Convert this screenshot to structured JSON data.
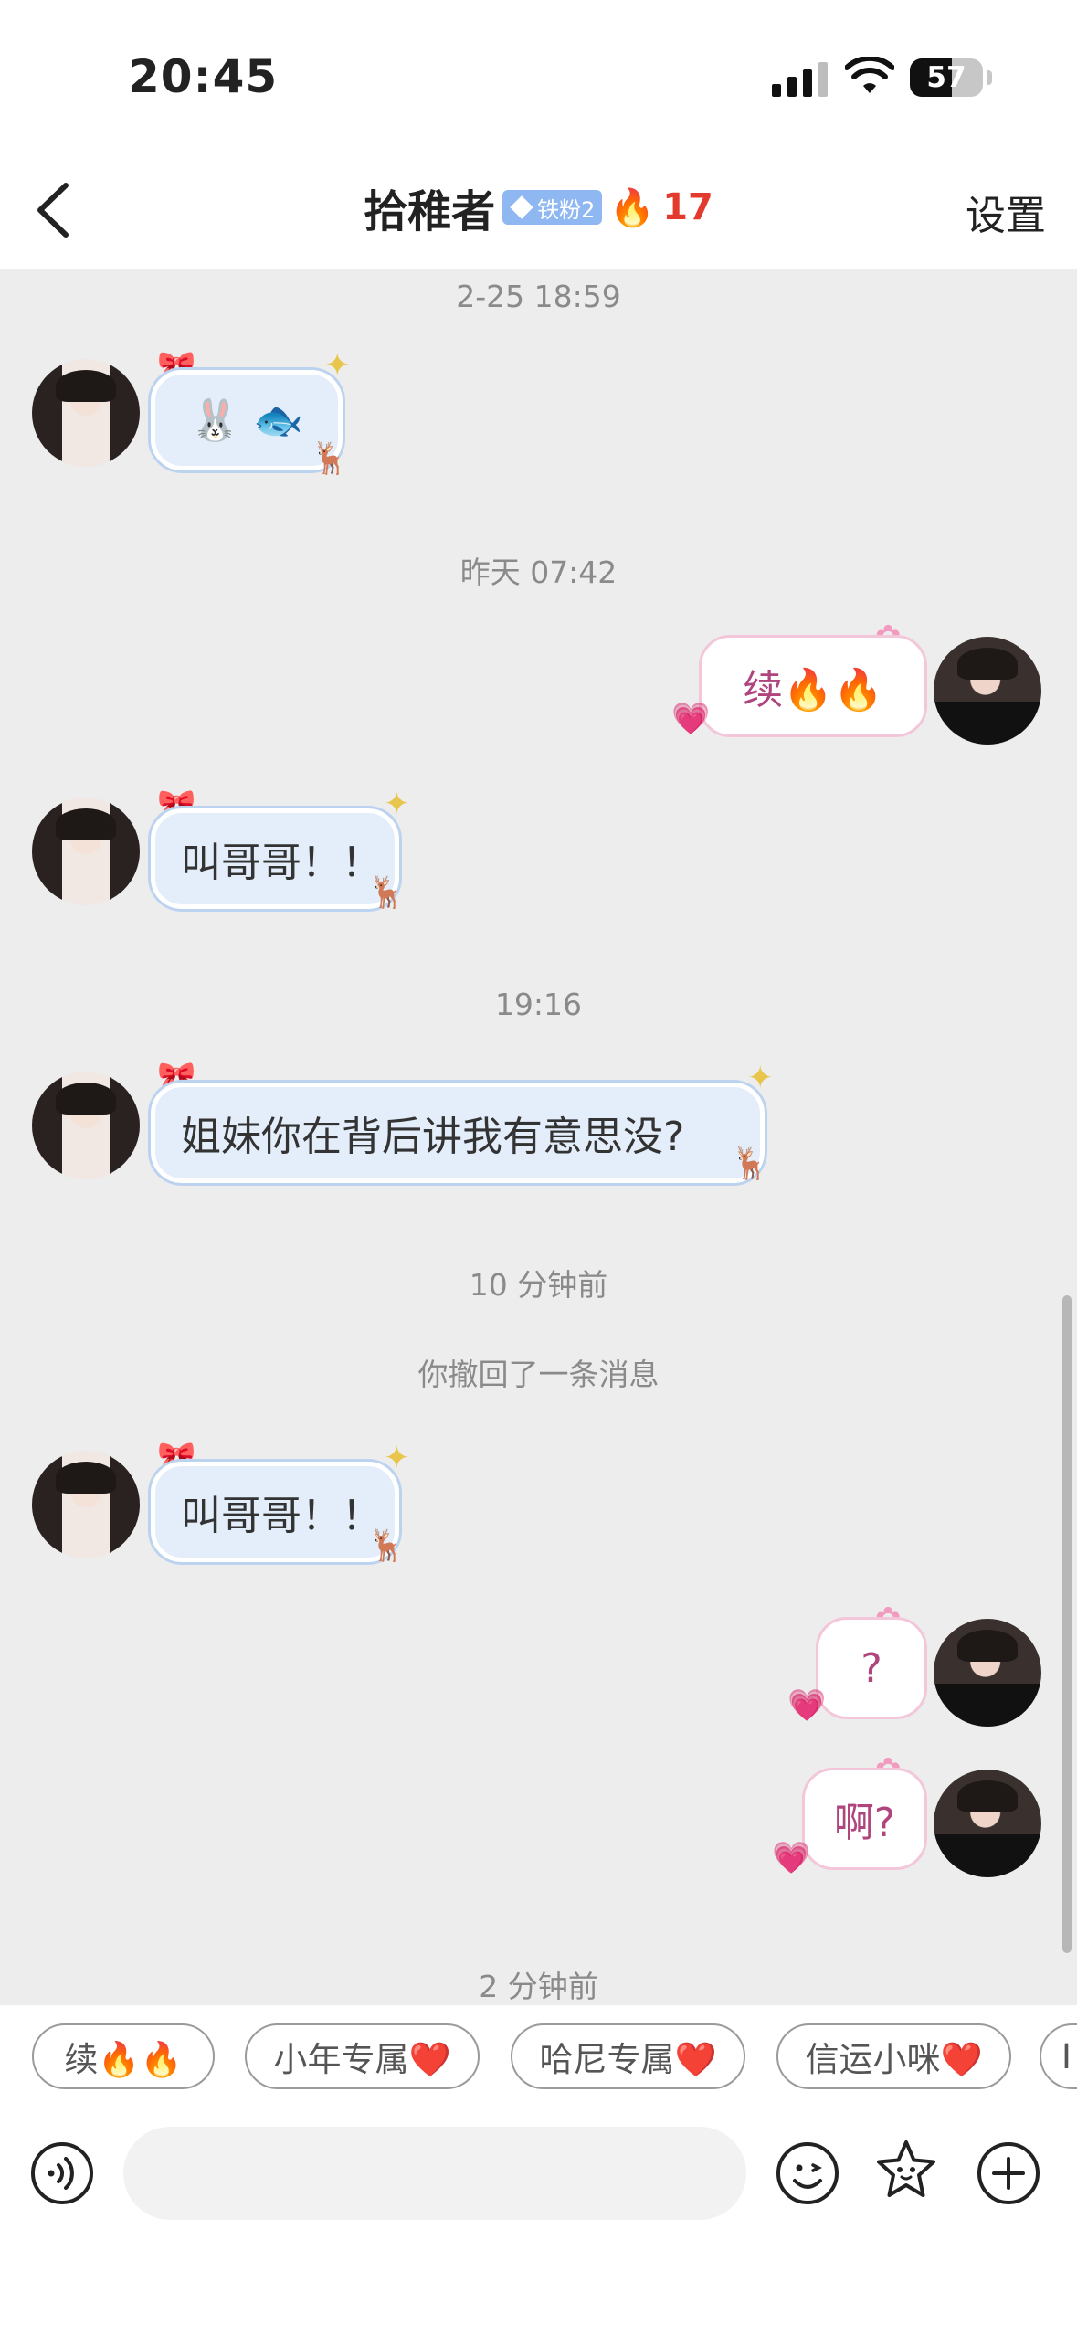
{
  "status_bar": {
    "time": "20:45",
    "battery": "57",
    "battery_level": 0.57
  },
  "header": {
    "title": "拾稚者",
    "fan_badge": "铁粉2",
    "streak_icon": "🔥",
    "streak_count": "17",
    "settings_label": "设置"
  },
  "messages": [
    {
      "type": "timestamp",
      "text": "2-25 18:59"
    },
    {
      "type": "incoming",
      "text": "🐰 🐟"
    },
    {
      "type": "timestamp",
      "text": "昨天 07:42"
    },
    {
      "type": "outgoing",
      "text": "续🔥🔥"
    },
    {
      "type": "incoming",
      "text": "叫哥哥！！"
    },
    {
      "type": "timestamp",
      "text": "19:16"
    },
    {
      "type": "incoming",
      "text": "姐妹你在背后讲我有意思没?"
    },
    {
      "type": "timestamp",
      "text": "10 分钟前"
    },
    {
      "type": "system",
      "text": "你撤回了一条消息"
    },
    {
      "type": "incoming",
      "text": "叫哥哥！！"
    },
    {
      "type": "outgoing",
      "text": "?"
    },
    {
      "type": "outgoing",
      "text": "啊?"
    },
    {
      "type": "timestamp",
      "text": "2 分钟前"
    }
  ],
  "quick_replies": [
    "续🔥🔥",
    "小年专属❤️",
    "哈尼专属❤️",
    "信运小咪❤️",
    "I"
  ],
  "input": {
    "placeholder": ""
  },
  "icons": {
    "back": "chevron-left-icon",
    "voice": "voice-icon",
    "emoji": "emoji-icon",
    "sticker": "star-sticker-icon",
    "add": "plus-circle-icon"
  },
  "colors": {
    "streak": "#e23b2e",
    "fan_badge": "#8fb7f2",
    "outgoing_text": "#b0457e",
    "chat_bg": "#ededed"
  }
}
